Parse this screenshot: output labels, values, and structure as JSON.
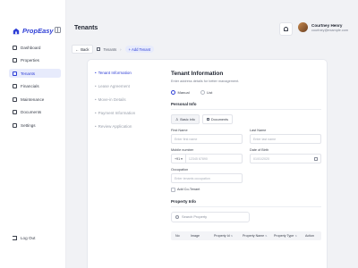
{
  "app": {
    "name": "PropEasy",
    "brand_color": "#2f3fd6"
  },
  "sidebar": {
    "items": [
      {
        "label": "Dashboard",
        "icon": "grid-icon",
        "active": false
      },
      {
        "label": "Properties",
        "icon": "building-icon",
        "active": false
      },
      {
        "label": "Tenants",
        "icon": "users-icon",
        "active": true
      },
      {
        "label": "Financials",
        "icon": "chart-icon",
        "active": false
      },
      {
        "label": "Maintenance",
        "icon": "wrench-icon",
        "active": false
      },
      {
        "label": "Documents",
        "icon": "document-icon",
        "active": false
      },
      {
        "label": "Settings",
        "icon": "gear-icon",
        "active": false
      }
    ],
    "logout": "Log Out"
  },
  "header": {
    "title": "Tenants",
    "user": {
      "name": "Courtney Henry",
      "email": "courtney@example.com"
    }
  },
  "breadcrumb": {
    "back": "Back",
    "items": [
      "Tenants",
      "Add Tenant"
    ]
  },
  "steps": [
    {
      "label": "Tenant Information",
      "active": true
    },
    {
      "label": "Lease Agreement",
      "active": false
    },
    {
      "label": "Move-in Details",
      "active": false
    },
    {
      "label": "Payment Information",
      "active": false
    },
    {
      "label": "Review Application",
      "active": false
    }
  ],
  "form": {
    "title": "Tenant Information",
    "subtitle": "Enter address details for better management.",
    "radio_manual": "Manual",
    "radio_list": "List",
    "personal_info": "Personal Info",
    "tab_basic": "Basic info",
    "tab_documents": "Documents",
    "first_name_label": "First Name",
    "first_name_placeholder": "Enter first name",
    "last_name_label": "Last Name",
    "last_name_placeholder": "Enter last name",
    "mobile_label": "Mobile number",
    "country_code": "+91",
    "mobile_placeholder": "12345 67890",
    "dob_label": "Date of Birth",
    "dob_placeholder": "01/01/2020",
    "occupation_label": "Occupation",
    "occupation_placeholder": "Enter tenants occupation",
    "co_tenant": "Add Co-Tenant",
    "property_info": "Property Info",
    "search_placeholder": "Search Property",
    "table_columns": [
      "No",
      "Image",
      "Property Id",
      "Property Name",
      "Property Type",
      "Action"
    ]
  }
}
